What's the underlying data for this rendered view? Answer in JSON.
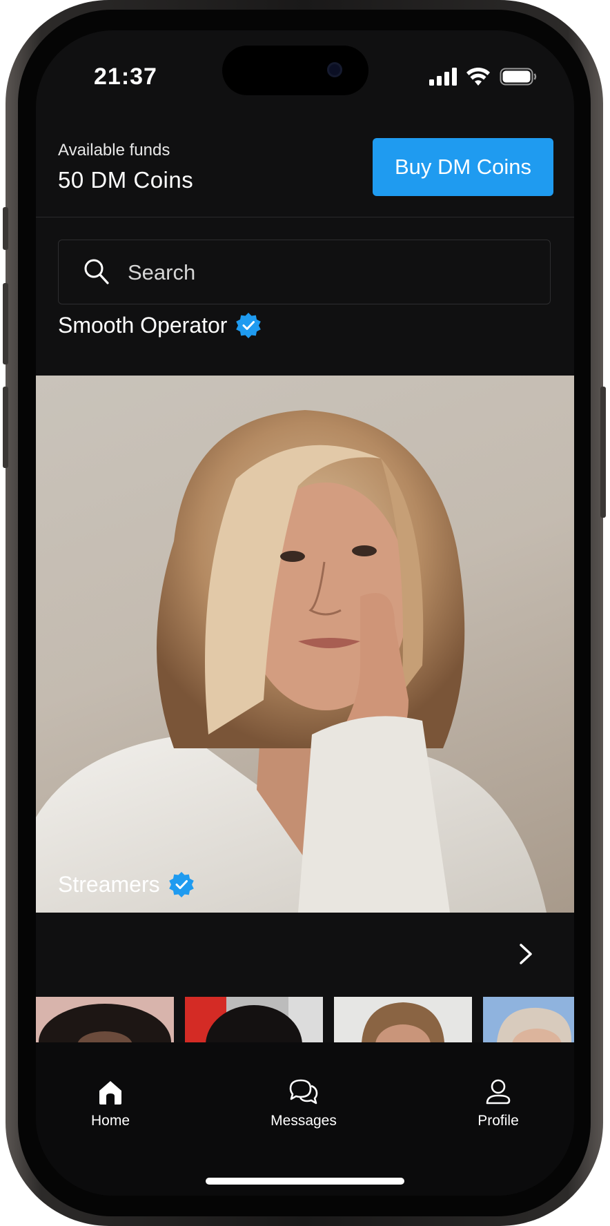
{
  "status_bar": {
    "time": "21:37"
  },
  "header": {
    "funds_label": "Available funds",
    "funds_value": "50 DM Coins",
    "buy_button": "Buy DM Coins"
  },
  "search": {
    "placeholder": "Search"
  },
  "featured": {
    "title": "Smooth Operator",
    "verified": true
  },
  "streamers": {
    "title": "Streamers",
    "verified": true
  },
  "tabs": [
    {
      "label": "Home",
      "icon": "home-icon"
    },
    {
      "label": "Messages",
      "icon": "chat-bubbles-icon"
    },
    {
      "label": "Profile",
      "icon": "user-icon"
    }
  ],
  "colors": {
    "accent": "#1f9bf0",
    "background": "#101011",
    "text": "#ffffff"
  }
}
